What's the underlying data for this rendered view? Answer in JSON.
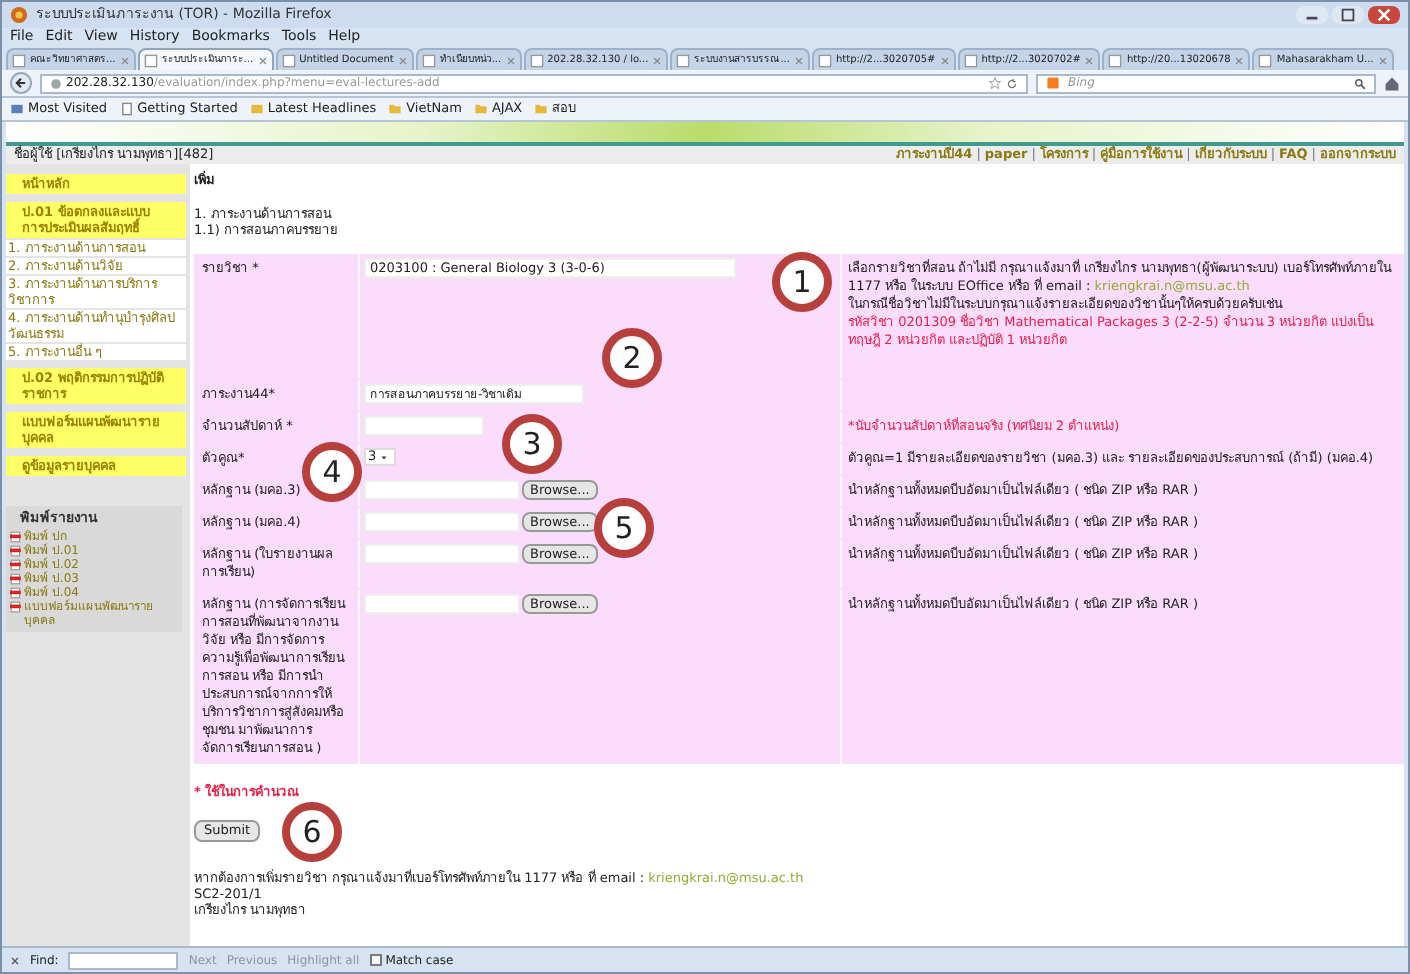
{
  "window": {
    "title": "ระบบประเมินภาระงาน (TOR) - Mozilla Firefox"
  },
  "menu": [
    "File",
    "Edit",
    "View",
    "History",
    "Bookmarks",
    "Tools",
    "Help"
  ],
  "tabs": [
    {
      "label": "คณะวิทยาศาสตร...",
      "selected": false
    },
    {
      "label": "ระบบประเมินภาระ...",
      "selected": true
    },
    {
      "label": "Untitled Document",
      "selected": false
    },
    {
      "label": "ทำเนียบหน่ว...",
      "selected": false
    },
    {
      "label": "202.28.32.130 / lo...",
      "selected": false
    },
    {
      "label": "ระบบงานสารบรรณ...",
      "selected": false
    },
    {
      "label": "http://2...3020705#",
      "selected": false
    },
    {
      "label": "http://2...3020702#",
      "selected": false
    },
    {
      "label": "http://20...13020678",
      "selected": false
    },
    {
      "label": "Mahasarakham U...",
      "selected": false
    }
  ],
  "address_bar": {
    "host": "202.28.32.130",
    "path": "/evaluation/index.php?menu=eval-lectures-add",
    "search_placeholder": "Bing"
  },
  "bookmarks": [
    {
      "label": "Most Visited",
      "kind": "menu"
    },
    {
      "label": "Getting Started",
      "kind": "page"
    },
    {
      "label": "Latest Headlines",
      "kind": "feed"
    },
    {
      "label": "VietNam",
      "kind": "folder"
    },
    {
      "label": "AJAX",
      "kind": "folder"
    },
    {
      "label": "สอบ",
      "kind": "folder"
    }
  ],
  "user_bar": {
    "user": "ชื่อผู้ใช้ [เกรียงไกร นามพุทธา][482]",
    "separator": "|",
    "links": [
      "ภาระงานปี44",
      "paper",
      "โครงการ",
      "คู่มือการใช้งาน",
      "เกี่ยวกับระบบ",
      "FAQ",
      "ออกจากระบบ"
    ]
  },
  "sidebar": {
    "items": [
      {
        "kind": "heading",
        "label": "หน้าหลัก"
      },
      {
        "kind": "heading",
        "label": "ป.01 ข้อตกลงและแบบการประเมินผลสัมฤทธิ์"
      },
      {
        "kind": "link",
        "number": "1.",
        "label": "ภาระงานด้านการสอน"
      },
      {
        "kind": "link",
        "number": "2.",
        "label": "ภาระงานด้านวิจัย"
      },
      {
        "kind": "link",
        "number": "3.",
        "label": "ภาระงานด้านการบริการวิชาการ"
      },
      {
        "kind": "link",
        "number": "4.",
        "label": "ภาระงานด้านทำนุบำรุงศิลปวัฒนธรรม"
      },
      {
        "kind": "link",
        "number": "5.",
        "label": "ภาระงานอื่น ๆ"
      },
      {
        "kind": "heading",
        "label": "ป.02 พฤติกรรมการปฏิบัติราชการ"
      },
      {
        "kind": "heading",
        "label": "แบบฟอร์มแผนพัฒนารายบุคคล"
      },
      {
        "kind": "heading",
        "label": "ดูข้อมูลรายบุคคล"
      }
    ],
    "print": {
      "title": "พิมพ์รายงาน",
      "items": [
        "พิมพ์ ปก",
        "พิมพ์ ป.01",
        "พิมพ์ ป.02",
        "พิมพ์ ป.03",
        "พิมพ์ ป.04",
        "แบบฟอร์มแผนพัฒนารายบุคคล"
      ]
    }
  },
  "form": {
    "heading": "เพิ่ม",
    "path": [
      "1. ภาระงานด้านการสอน",
      "1.1) การสอนภาคบรรยาย"
    ],
    "rows": [
      {
        "label": "รายวิชา *",
        "kind": "select",
        "value": "0203100 : General Biology 3 (3-0-6)",
        "notes": [
          {
            "warning": false,
            "text": "เลือกรายวิชาที่สอน ถ้าไม่มี กรุณาแจ้งมาที่ เกรียงไกร นามพุทธา(ผู้พัฒนาระบบ) เบอร์โทรศัพท์ภายใน 1177 หรือ ในระบบ EOffice หรือ ที่ email : ",
            "link": "kriengkrai.n@msu.ac.th"
          },
          {
            "warning": false,
            "text": "ในกรณีชื่อวิชาไม่มีในระบบกรุณาแจ้งรายละเอียดของวิชานั้นๆให้ครบด้วยครับเช่น"
          },
          {
            "warning": true,
            "text": "รหัสวิชา 0201309 ชื่อวิชา Mathematical Packages 3 (2-2-5) จำนวน 3 หน่วยกิต แบ่งเป็น ทฤษฎี 2 หน่วยกิต และปฏิบัติ 1 หน่วยกิต"
          }
        ]
      },
      {
        "label": "ภาระงาน44*",
        "kind": "select",
        "value": "การสอนภาคบรรยาย-วิชาเดิม"
      },
      {
        "label": "จำนวนสัปดาห์ *",
        "kind": "text",
        "notes": [
          {
            "warning": true,
            "text": "*นับจำนวนสัปดาห์ที่สอนจริง (ทศนิยม 2 ตำแหน่ง)"
          }
        ]
      },
      {
        "label": "ตัวคูณ*",
        "kind": "small_select",
        "value": "3",
        "notes": [
          {
            "warning": false,
            "text": "ตัวคูณ=1 มีรายละเอียดของรายวิชา (มคอ.3) และ รายละเอียดของประสบการณ์ (ถ้ามี) (มคอ.4)"
          }
        ]
      },
      {
        "label": "หลักฐาน (มคอ.3)",
        "kind": "file",
        "button": "Browse...",
        "notes": [
          {
            "warning": false,
            "text": "นำหลักฐานทั้งหมดบีบอัดมาเป็นไฟล์เดียว ( ชนิด ZIP หรือ RAR )"
          }
        ]
      },
      {
        "label": "หลักฐาน (มคอ.4)",
        "kind": "file",
        "button": "Browse...",
        "notes": [
          {
            "warning": false,
            "text": "นำหลักฐานทั้งหมดบีบอัดมาเป็นไฟล์เดียว ( ชนิด ZIP หรือ RAR )"
          }
        ]
      },
      {
        "label": "หลักฐาน (ใบรายงานผลการเรียน)",
        "kind": "file",
        "button": "Browse...",
        "notes": [
          {
            "warning": false,
            "text": "นำหลักฐานทั้งหมดบีบอัดมาเป็นไฟล์เดียว ( ชนิด ZIP หรือ RAR )"
          }
        ]
      },
      {
        "label": "หลักฐาน (การจัดการเรียนการสอนที่พัฒนาจากงานวิจัย หรือ มีการจัดการความรู้เพื่อพัฒนาการเรียนการสอน หรือ มีการนำประสบการณ์จากการให้บริการวิชาการสู่สังคมหรือชุมชน มาพัฒนาการจัดการเรียนการสอน )",
        "kind": "file",
        "button": "Browse...",
        "notes": [
          {
            "warning": false,
            "text": "นำหลักฐานทั้งหมดบีบอัดมาเป็นไฟล์เดียว ( ชนิด ZIP หรือ RAR )"
          }
        ]
      }
    ],
    "required_note": "* ใช้ในการคำนวณ",
    "submit": "Submit"
  },
  "footer": {
    "text": "หากต้องการเพิ่มรายวิชา กรุณาแจ้งมาที่เบอร์โทรศัพท์ภายใน 1177 หรือ ที่ email : ",
    "link": "kriengkrai.n@msu.ac.th",
    "lines": [
      "SC2-201/1",
      "เกรียงไกร นามพุทธา"
    ]
  },
  "annotations": [
    "1",
    "2",
    "3",
    "4",
    "5",
    "6"
  ],
  "find_bar": {
    "label": "Find:",
    "buttons": [
      "Next",
      "Previous",
      "Highlight all"
    ],
    "match_case": {
      "label": "Match case",
      "checked": false
    }
  }
}
